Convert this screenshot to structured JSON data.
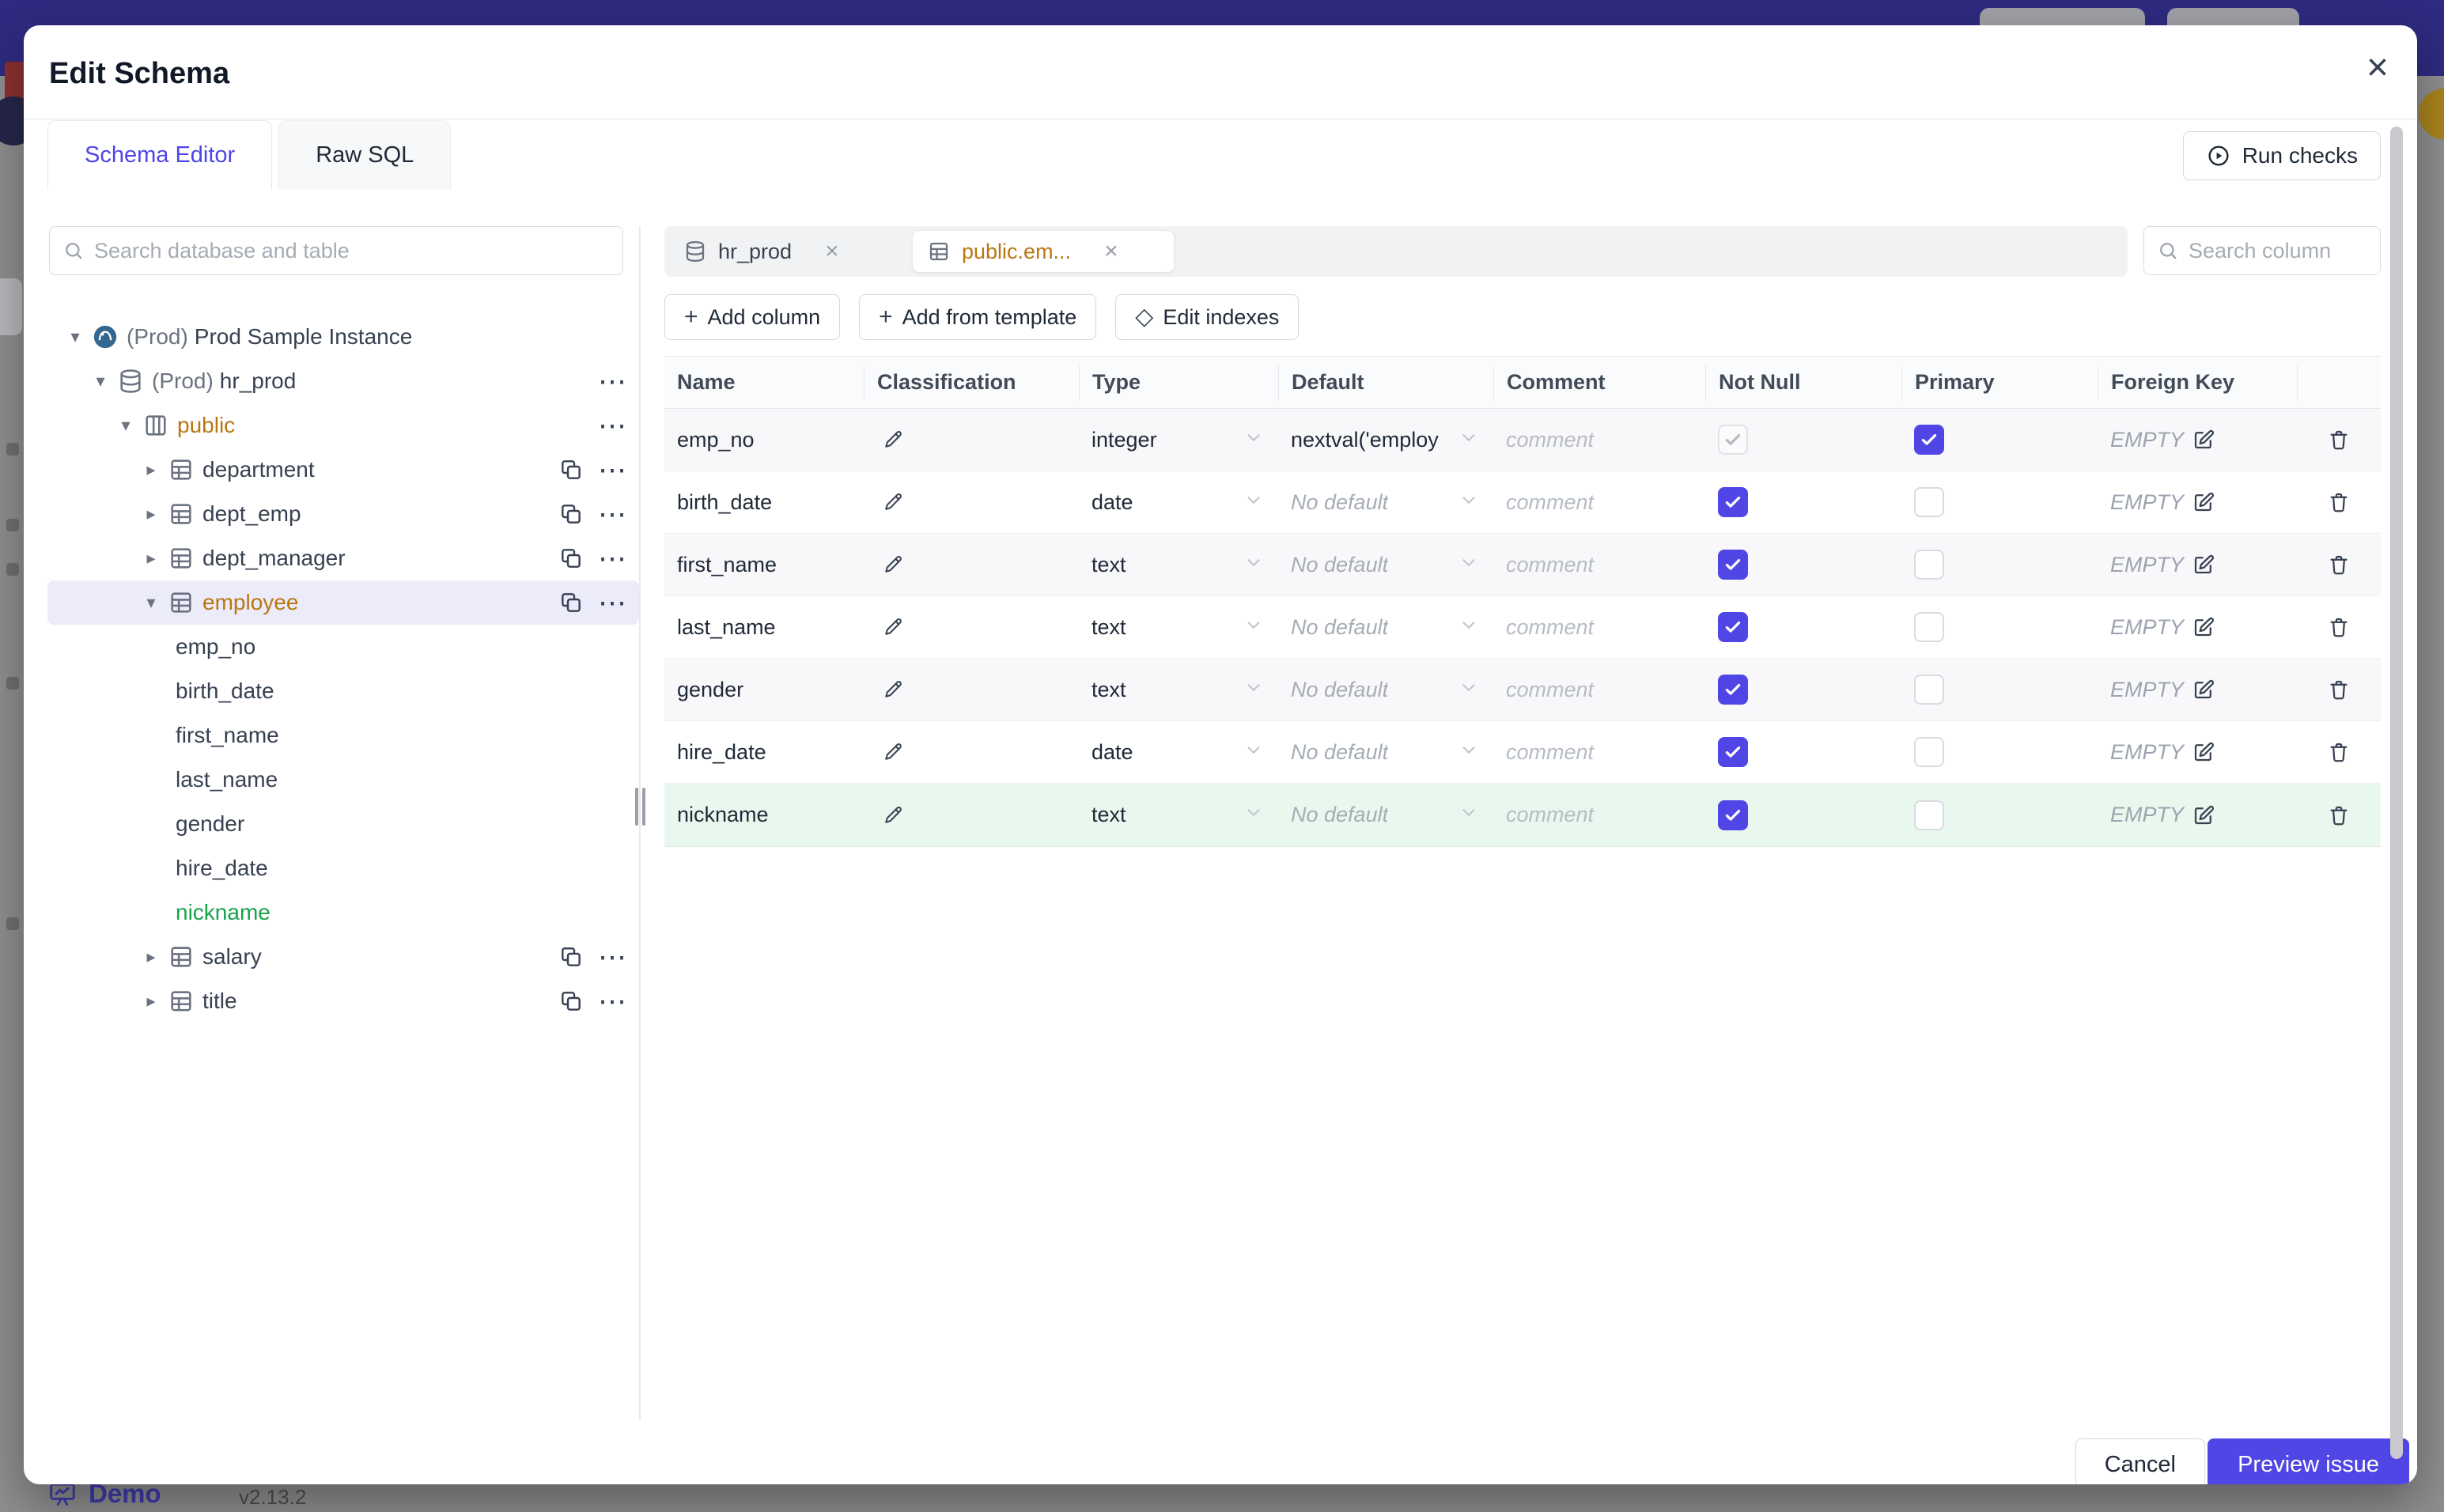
{
  "modal": {
    "title": "Edit Schema",
    "close_glyph": "×"
  },
  "tabs": {
    "schema_editor": "Schema Editor",
    "raw_sql": "Raw SQL"
  },
  "run_checks_label": "Run checks",
  "sidebar": {
    "search_placeholder": "Search database and table",
    "tree": [
      {
        "prefix": "(Prod)",
        "label": "Prod Sample Instance"
      },
      {
        "prefix": "(Prod)",
        "label": "hr_prod"
      },
      {
        "label": "public",
        "state": "modified"
      },
      {
        "label": "department"
      },
      {
        "label": "dept_emp"
      },
      {
        "label": "dept_manager"
      },
      {
        "label": "employee",
        "state": "modified"
      },
      {
        "label": "emp_no"
      },
      {
        "label": "birth_date"
      },
      {
        "label": "first_name"
      },
      {
        "label": "last_name"
      },
      {
        "label": "gender"
      },
      {
        "label": "hire_date"
      },
      {
        "label": "nickname",
        "state": "added"
      },
      {
        "label": "salary"
      },
      {
        "label": "title"
      }
    ],
    "more_glyph": "⋯",
    "chevron_open": "▾",
    "chevron_closed": "▸"
  },
  "editor": {
    "chips": [
      {
        "label": "hr_prod",
        "close": "×"
      },
      {
        "label": "public.em...",
        "close": "×",
        "state": "modified"
      }
    ],
    "search_placeholder": "Search column",
    "toolbar": {
      "plus_glyph": "+",
      "diamond_glyph": "◇",
      "add_column": "Add column",
      "add_from_template": "Add from template",
      "edit_indexes": "Edit indexes"
    },
    "table": {
      "headers": {
        "name": "Name",
        "classification": "Classification",
        "type": "Type",
        "default": "Default",
        "comment": "Comment",
        "not_null": "Not Null",
        "primary": "Primary",
        "foreign_key": "Foreign Key"
      },
      "rows": [
        {
          "name": "emp_no",
          "type": "integer",
          "default": "nextval('employ",
          "default_state": "value",
          "comment": "comment",
          "not_null": "checked-disabled",
          "primary": "checked",
          "foreign_key": "EMPTY"
        },
        {
          "name": "birth_date",
          "type": "date",
          "default": "No default",
          "default_state": "placeholder",
          "comment": "comment",
          "not_null": "checked",
          "primary": "unchecked",
          "foreign_key": "EMPTY"
        },
        {
          "name": "first_name",
          "type": "text",
          "default": "No default",
          "default_state": "placeholder",
          "comment": "comment",
          "not_null": "checked",
          "primary": "unchecked",
          "foreign_key": "EMPTY"
        },
        {
          "name": "last_name",
          "type": "text",
          "default": "No default",
          "default_state": "placeholder",
          "comment": "comment",
          "not_null": "checked",
          "primary": "unchecked",
          "foreign_key": "EMPTY"
        },
        {
          "name": "gender",
          "type": "text",
          "default": "No default",
          "default_state": "placeholder",
          "comment": "comment",
          "not_null": "checked",
          "primary": "unchecked",
          "foreign_key": "EMPTY"
        },
        {
          "name": "hire_date",
          "type": "date",
          "default": "No default",
          "default_state": "placeholder",
          "comment": "comment",
          "not_null": "checked",
          "primary": "unchecked",
          "foreign_key": "EMPTY"
        },
        {
          "name": "nickname",
          "type": "text",
          "default": "No default",
          "default_state": "placeholder",
          "comment": "comment",
          "not_null": "checked",
          "primary": "unchecked",
          "foreign_key": "EMPTY",
          "state": "added"
        }
      ],
      "fk_empty_label": "EMPTY"
    }
  },
  "footer": {
    "cancel": "Cancel",
    "primary": "Preview issue"
  },
  "backdrop": {
    "demo": "Demo",
    "version": "v2.13.2"
  },
  "colors": {
    "accent": "#4f46e5",
    "modified": "#b8770e",
    "added": "#16a34a",
    "added_row_bg": "#e9f8ef",
    "selected_row_bg": "#ecebfa",
    "topbar": "#2e2b80"
  }
}
